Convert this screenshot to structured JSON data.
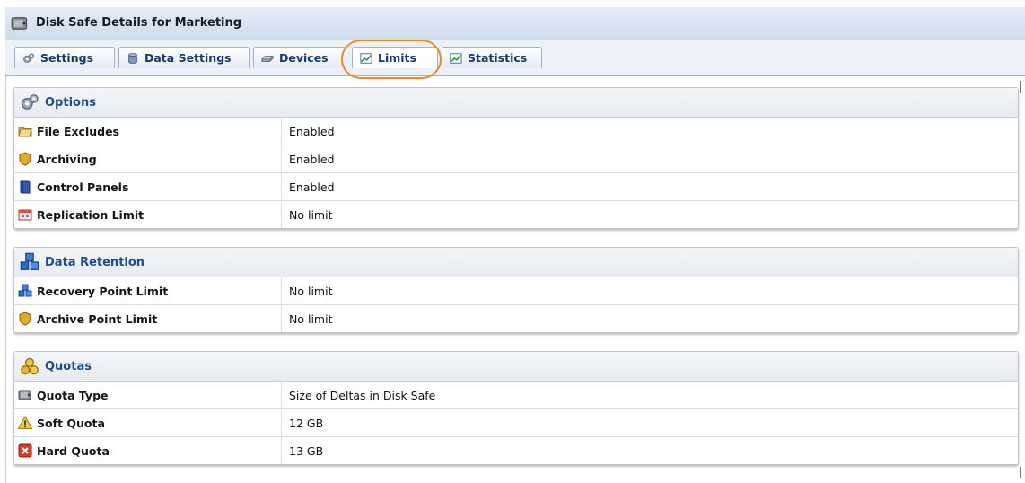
{
  "window": {
    "title": "Disk Safe Details for Marketing",
    "icon": "disk-safe-icon"
  },
  "tabs": [
    {
      "label": "Settings",
      "icon": "gears-icon"
    },
    {
      "label": "Data Settings",
      "icon": "database-icon"
    },
    {
      "label": "Devices",
      "icon": "drive-icon"
    },
    {
      "label": "Limits",
      "icon": "chart-icon",
      "active": true
    },
    {
      "label": "Statistics",
      "icon": "chart-icon"
    }
  ],
  "highlight_color": "#f08a24",
  "sections": [
    {
      "title": "Options",
      "icon": "gears-icon",
      "rows": [
        {
          "label": "File Excludes",
          "value": "Enabled",
          "icon": "folder-icon"
        },
        {
          "label": "Archiving",
          "value": "Enabled",
          "icon": "archive-shield-icon"
        },
        {
          "label": "Control Panels",
          "value": "Enabled",
          "icon": "book-icon"
        },
        {
          "label": "Replication Limit",
          "value": "No limit",
          "icon": "replication-icon"
        }
      ]
    },
    {
      "title": "Data Retention",
      "icon": "cubes-icon",
      "rows": [
        {
          "label": "Recovery Point Limit",
          "value": "No limit",
          "icon": "cubes-icon"
        },
        {
          "label": "Archive Point Limit",
          "value": "No limit",
          "icon": "archive-shield-icon"
        }
      ]
    },
    {
      "title": "Quotas",
      "icon": "coins-icon",
      "rows": [
        {
          "label": "Quota Type",
          "value": "Size of Deltas in Disk Safe",
          "icon": "disk-safe-icon"
        },
        {
          "label": "Soft Quota",
          "value": "12 GB",
          "icon": "warning-icon"
        },
        {
          "label": "Hard Quota",
          "value": "13 GB",
          "icon": "error-icon"
        }
      ]
    }
  ]
}
